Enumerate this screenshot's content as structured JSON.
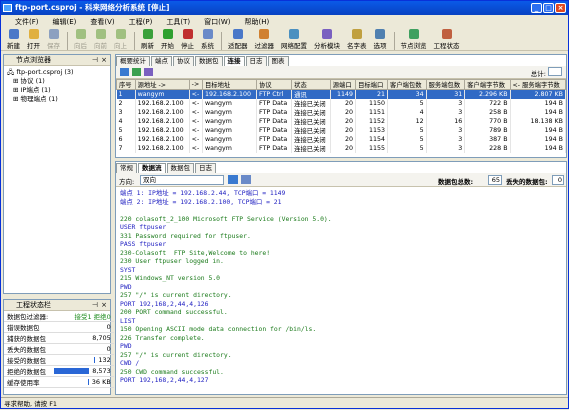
{
  "window": {
    "title": "ftp-port.csproj - 科来网络分析系统 [停止]"
  },
  "menu": [
    "文件(F)",
    "编辑(E)",
    "查看(V)",
    "工程(P)",
    "工具(T)",
    "窗口(W)",
    "帮助(H)"
  ],
  "toolbar": [
    {
      "label": "新建",
      "color": "#4a78c8",
      "enabled": true
    },
    {
      "label": "打开",
      "color": "#e0b040",
      "enabled": true
    },
    {
      "label": "保存",
      "color": "#8ca0c0",
      "enabled": false
    },
    {
      "label": "向后",
      "color": "#a0c080",
      "enabled": false
    },
    {
      "label": "向前",
      "color": "#a0c080",
      "enabled": false
    },
    {
      "label": "向上",
      "color": "#a0c080",
      "enabled": false
    },
    {
      "label": "刷新",
      "color": "#3aa03a",
      "enabled": true
    },
    {
      "label": "开始",
      "color": "#2fa02f",
      "enabled": true
    },
    {
      "label": "停止",
      "color": "#c03030",
      "enabled": true
    },
    {
      "label": "系统",
      "color": "#6a8ac8",
      "enabled": true
    },
    {
      "label": "适配器",
      "color": "#4a78c8",
      "enabled": true
    },
    {
      "label": "过滤器",
      "color": "#d08030",
      "enabled": true
    },
    {
      "label": "网络配置",
      "color": "#4a90c0",
      "enabled": true
    },
    {
      "label": "分析模块",
      "color": "#7a60c0",
      "enabled": true
    },
    {
      "label": "名字表",
      "color": "#c0a040",
      "enabled": true
    },
    {
      "label": "选项",
      "color": "#5080b0",
      "enabled": true
    },
    {
      "label": "节点浏览",
      "color": "#40a060",
      "enabled": true
    },
    {
      "label": "工程状态",
      "color": "#c06040",
      "enabled": true
    }
  ],
  "node_panel": {
    "title": "节点浏览器",
    "items": [
      "ftp-port.csproj (3)",
      "协议 (1)",
      "IP端点 (1)",
      "物理端点 (1)"
    ]
  },
  "status_panel": {
    "title": "工程状态栏",
    "header_label": "数据包过滤器:",
    "header_value": "接受1 拒绝0",
    "rows": [
      {
        "label": "错误数据包",
        "value": "0",
        "fill": 0
      },
      {
        "label": "捕获的数据包",
        "value": "8,705",
        "fill": 0
      },
      {
        "label": "丢失的数据包",
        "value": "0",
        "fill": 0
      },
      {
        "label": "接受的数据包",
        "value": "132",
        "fill": 0.02
      },
      {
        "label": "拒绝的数据包",
        "value": "8,573",
        "fill": 0.98
      },
      {
        "label": "缓存使用率",
        "value": "36 KB",
        "fill": 0.03
      }
    ]
  },
  "top_tabs": [
    "概要统计",
    "端点",
    "协议",
    "数据包",
    "连接",
    "日志",
    "图表"
  ],
  "active_top_tab": "连接",
  "page_label": "总计:",
  "conn_table": {
    "headers": [
      "序号",
      "源地址 ->",
      "->",
      "目标地址",
      "协议",
      "状态",
      "源端口",
      "目标端口",
      "客户端包数",
      "服务端包数",
      "客户端字节数",
      "<- 服务端字节数"
    ],
    "rows": [
      [
        "1",
        "wangym",
        "<-",
        "192.168.2.100",
        "FTP Ctrl",
        "通讯",
        "1149",
        "21",
        "34",
        "31",
        "2.296 KB",
        "2.807 KB"
      ],
      [
        "2",
        "192.168.2.100",
        "<-",
        "wangym",
        "FTP Data",
        "连接已关闭",
        "20",
        "1150",
        "5",
        "3",
        "722 B",
        "194 B"
      ],
      [
        "3",
        "192.168.2.100",
        "<-",
        "wangym",
        "FTP Data",
        "连接已关闭",
        "20",
        "1151",
        "4",
        "3",
        "258 B",
        "194 B"
      ],
      [
        "4",
        "192.168.2.100",
        "<-",
        "wangym",
        "FTP Data",
        "连接已关闭",
        "20",
        "1152",
        "12",
        "16",
        "770 B",
        "18.138 KB"
      ],
      [
        "5",
        "192.168.2.100",
        "<-",
        "wangym",
        "FTP Data",
        "连接已关闭",
        "20",
        "1153",
        "5",
        "3",
        "789 B",
        "194 B"
      ],
      [
        "6",
        "192.168.2.100",
        "<-",
        "wangym",
        "FTP Data",
        "连接已关闭",
        "20",
        "1154",
        "5",
        "3",
        "387 B",
        "194 B"
      ],
      [
        "7",
        "192.168.2.100",
        "<-",
        "wangym",
        "FTP Data",
        "连接已关闭",
        "20",
        "1155",
        "5",
        "3",
        "228 B",
        "194 B"
      ]
    ]
  },
  "bottom_tabs": [
    "常规",
    "数据流",
    "数据包",
    "日志"
  ],
  "active_bottom_tab": "数据流",
  "direction_label": "方向:",
  "direction_value": "双向",
  "packet_count_label": "数据包总数:",
  "packet_count": "65",
  "lost_label": "丢失的数据包:",
  "lost_value": "0",
  "stream_header": [
    "端点 1: IP地址 = 192.168.2.44, TCP端口 = 1149",
    "端点 2: IP地址 = 192.168.2.100, TCP端口 = 21"
  ],
  "stream_lines": [
    {
      "t": "220 colasoft_2_100 Microsoft FTP Service (Version 5.0).",
      "s": "srv"
    },
    {
      "t": "USER ftpuser",
      "s": "cli"
    },
    {
      "t": "331 Password required for ftpuser.",
      "s": "srv"
    },
    {
      "t": "PASS ftpuser",
      "s": "cli"
    },
    {
      "t": "230-Colasoft  FTP Site,Welcome to here!",
      "s": "srv"
    },
    {
      "t": "230 User ftpuser logged in.",
      "s": "srv"
    },
    {
      "t": "SYST",
      "s": "cli"
    },
    {
      "t": "215 Windows_NT version 5.0",
      "s": "srv"
    },
    {
      "t": "PWD",
      "s": "cli"
    },
    {
      "t": "257 \"/\" is current directory.",
      "s": "srv"
    },
    {
      "t": "PORT 192,168,2,44,4,126",
      "s": "cli"
    },
    {
      "t": "200 PORT command successful.",
      "s": "srv"
    },
    {
      "t": "LIST",
      "s": "cli"
    },
    {
      "t": "150 Opening ASCII mode data connection for /bin/ls.",
      "s": "srv"
    },
    {
      "t": "226 Transfer complete.",
      "s": "srv"
    },
    {
      "t": "PWD",
      "s": "cli"
    },
    {
      "t": "257 \"/\" is current directory.",
      "s": "srv"
    },
    {
      "t": "CWD /",
      "s": "cli"
    },
    {
      "t": "250 CWD command successful.",
      "s": "srv"
    },
    {
      "t": "PORT 192,168,2,44,4,127",
      "s": "cli"
    }
  ],
  "statusbar": "寻求帮助, 请按 F1"
}
